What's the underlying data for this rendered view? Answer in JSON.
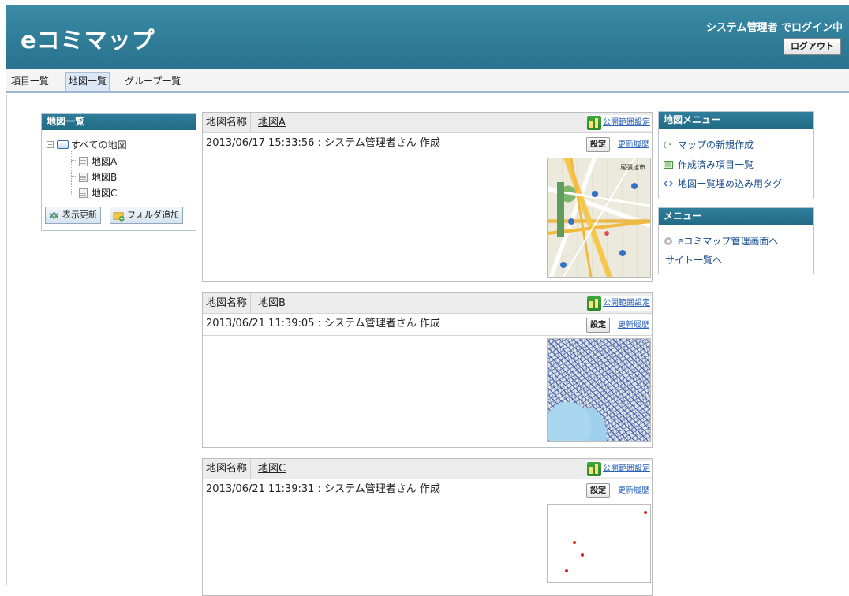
{
  "header": {
    "logo": "eコミマップ",
    "login_status": "システム管理者 でログイン中",
    "logout_label": "ログアウト"
  },
  "nav": {
    "tabs": [
      {
        "label": "項目一覧",
        "active": false
      },
      {
        "label": "地図一覧",
        "active": true
      },
      {
        "label": "グループ一覧",
        "active": false
      }
    ]
  },
  "map_tree": {
    "title": "地図一覧",
    "root": "すべての地図",
    "items": [
      "地図A",
      "地図B",
      "地図C"
    ],
    "refresh_label": "表示更新",
    "add_folder_label": "フォルダ追加"
  },
  "maps": [
    {
      "name_label": "地図名称",
      "name": "地図A",
      "publish_label": "公開範囲設定",
      "created": "2013/06/17 15:33:56 : システム管理者さん 作成",
      "settings_label": "設定",
      "history_label": "更新履歴",
      "thumbnail": "street-map"
    },
    {
      "name_label": "地図名称",
      "name": "地図B",
      "publish_label": "公開範囲設定",
      "created": "2013/06/21 11:39:05 : システム管理者さん 作成",
      "settings_label": "設定",
      "history_label": "更新履歴",
      "thumbnail": "dense-map"
    },
    {
      "name_label": "地図名称",
      "name": "地図C",
      "publish_label": "公開範囲設定",
      "created": "2013/06/21 11:39:31 : システム管理者さん 作成",
      "settings_label": "設定",
      "history_label": "更新履歴",
      "thumbnail": "points-map"
    }
  ],
  "map_menu": {
    "title": "地図メニュー",
    "items": [
      "マップの新規作成",
      "作成済み項目一覧",
      "地図一覧埋め込み用タグ"
    ]
  },
  "menu": {
    "title": "メニュー",
    "items": [
      "eコミマップ管理画面へ",
      "サイト一覧へ"
    ]
  },
  "colors": {
    "header": "#2f7c97",
    "panel_title": "#216b86",
    "link": "#1d4f8e"
  }
}
